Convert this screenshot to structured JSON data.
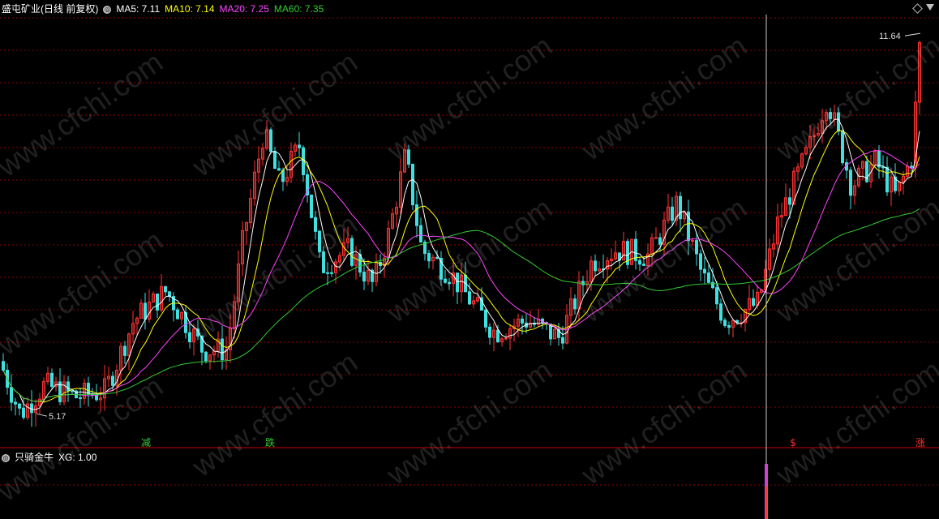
{
  "header": {
    "title": "盛屯矿业(日线 前复权)",
    "ma": [
      {
        "label": "MA5: 7.11",
        "color": "#ffffff"
      },
      {
        "label": "MA10: 7.14",
        "color": "#ffff00"
      },
      {
        "label": "MA20: 7.25",
        "color": "#ff44ff"
      },
      {
        "label": "MA60: 7.35",
        "color": "#33cc33"
      }
    ]
  },
  "sub_header": {
    "title": "只骑金牛",
    "value": "XG: 1.00"
  },
  "watermark": "www.cfchi.com",
  "chart_data": {
    "type": "candlestick",
    "price_range": [
      4.8,
      12.0
    ],
    "grid": true,
    "annotations": [
      {
        "text": "11.64",
        "value": 11.64,
        "kind": "max"
      },
      {
        "text": "5.17",
        "value": 5.17,
        "kind": "min"
      }
    ],
    "markers": [
      {
        "text": "减",
        "color": "#33cc33"
      },
      {
        "text": "跌",
        "color": "#33cc33"
      },
      {
        "text": "$",
        "color": "#ff3333"
      },
      {
        "text": "涨",
        "color": "#ff3333"
      }
    ],
    "indicator": {
      "name": "XG",
      "value": 1.0
    }
  },
  "colors": {
    "up": "#ff3333",
    "down": "#40e0e0",
    "grid": "#8b0000",
    "cursor": "#cccccc"
  }
}
